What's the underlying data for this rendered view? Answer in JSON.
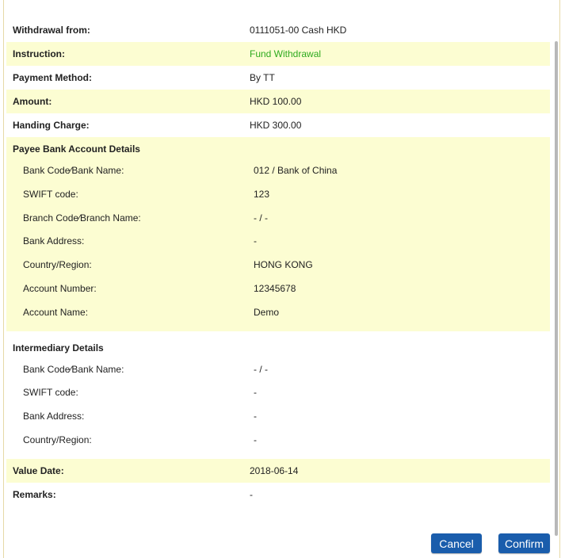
{
  "summary": [
    {
      "label": "Withdrawal from:",
      "value": "0111051-00 Cash HKD",
      "hl": false
    },
    {
      "label": "Instruction:",
      "value": "Fund Withdrawal",
      "hl": true,
      "green": true
    },
    {
      "label": "Payment Method:",
      "value": "By TT",
      "hl": false
    },
    {
      "label": "Amount:",
      "value": "HKD 100.00",
      "hl": true
    },
    {
      "label": "Handing Charge:",
      "value": "HKD 300.00",
      "hl": false
    }
  ],
  "payee": {
    "title": "Payee Bank Account Details",
    "items": [
      {
        "label": "Bank Code∕Bank Name:",
        "value": "012 / Bank of China"
      },
      {
        "label": "SWIFT code:",
        "value": "123"
      },
      {
        "label": "Branch Code∕Branch Name:",
        "value": "- / -"
      },
      {
        "label": "Bank Address:",
        "value": "-"
      },
      {
        "label": "Country/Region:",
        "value": "HONG KONG"
      },
      {
        "label": "Account Number:",
        "value": "12345678"
      },
      {
        "label": "Account Name:",
        "value": "Demo"
      }
    ]
  },
  "intermediary": {
    "title": "Intermediary Details",
    "items": [
      {
        "label": "Bank Code∕Bank Name:",
        "value": "- / -"
      },
      {
        "label": "SWIFT code:",
        "value": "-"
      },
      {
        "label": "Bank Address:",
        "value": "-"
      },
      {
        "label": "Country/Region:",
        "value": "-"
      }
    ]
  },
  "footer": [
    {
      "label": "Value Date:",
      "value": "2018-06-14",
      "hl": true
    },
    {
      "label": "Remarks:",
      "value": "-",
      "hl": false
    }
  ],
  "buttons": {
    "cancel": "Cancel",
    "confirm": "Confirm"
  },
  "colors": {
    "highlight": "#fcfdd2",
    "accent_green": "#2eaa1e",
    "button": "#1a5dac"
  }
}
